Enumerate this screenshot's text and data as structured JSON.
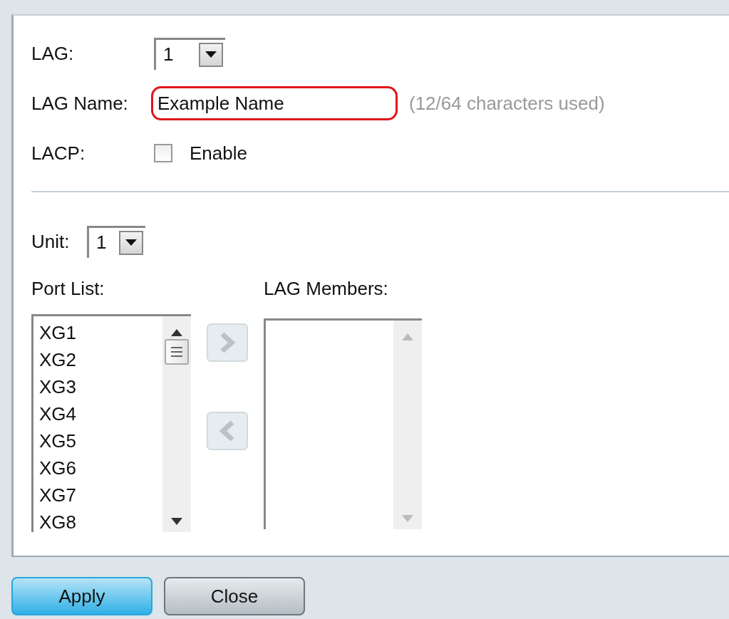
{
  "form": {
    "lag": {
      "label": "LAG:",
      "value": "1"
    },
    "lag_name": {
      "label": "LAG Name:",
      "value": "Example Name",
      "highlighted": true,
      "hint": "(12/64 characters used)"
    },
    "lacp": {
      "label": "LACP:",
      "option": "Enable",
      "checked": false
    }
  },
  "unit": {
    "label": "Unit:",
    "value": "1"
  },
  "port_list": {
    "label": "Port List:",
    "items": [
      {
        "label": "XG1",
        "selected": false
      },
      {
        "label": "XG2",
        "selected": false
      },
      {
        "label": "XG3",
        "selected": false
      },
      {
        "label": "XG4",
        "selected": false
      },
      {
        "label": "XG5",
        "selected": false
      },
      {
        "label": "XG6",
        "selected": false
      },
      {
        "label": "XG7",
        "selected": false
      },
      {
        "label": "XG8",
        "selected": false
      }
    ]
  },
  "move_buttons": [
    {
      "kind": "add",
      "disabled": true
    },
    {
      "kind": "remove",
      "disabled": true
    }
  ],
  "lag_members": {
    "label": "LAG Members:"
  },
  "buttons": [
    {
      "label": "Apply",
      "kind": "primary"
    },
    {
      "label": "Close",
      "kind": "secondary"
    }
  ]
}
